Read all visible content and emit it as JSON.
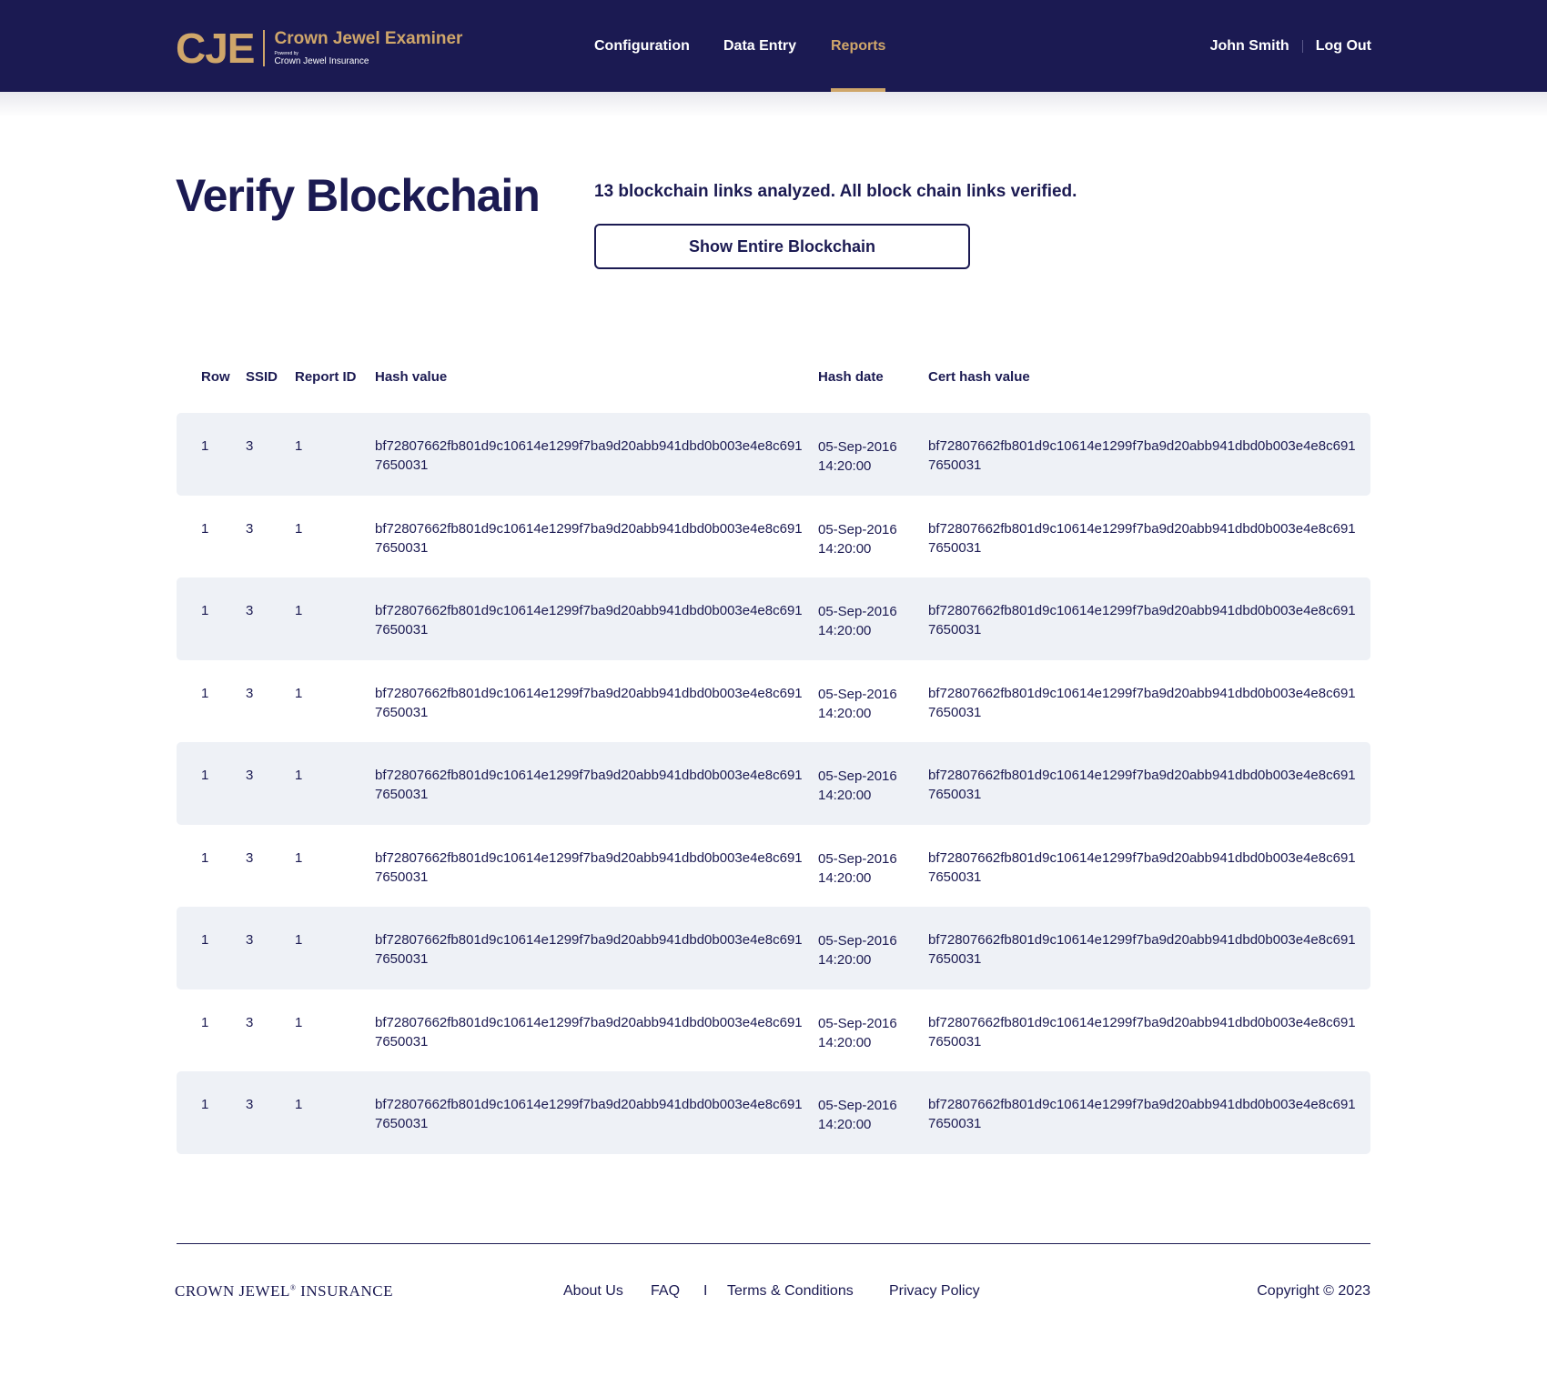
{
  "header": {
    "logo_mark": "CJE",
    "logo_title": "Crown Jewel Examiner",
    "logo_powered": "Powered by",
    "logo_subtitle": "Crown Jewel Insurance",
    "nav": [
      {
        "label": "Configuration",
        "active": false
      },
      {
        "label": "Data Entry",
        "active": false
      },
      {
        "label": "Reports",
        "active": true
      }
    ],
    "user_name": "John Smith",
    "logout_label": "Log Out"
  },
  "main": {
    "title": "Verify Blockchain",
    "status": "13 blockchain links analyzed. All block chain links verified.",
    "show_button_label": "Show Entire Blockchain"
  },
  "table": {
    "columns": [
      "Row",
      "SSID",
      "Report ID",
      "Hash value",
      "Hash date",
      "Cert hash value"
    ],
    "rows": [
      {
        "row": "1",
        "ssid": "3",
        "report_id": "1",
        "hash": "bf72807662fb801d9c10614e1299f7ba9d20abb941dbd0b003e4e8c6917650031",
        "date_line1": "05-Sep-2016",
        "date_line2": "14:20:00",
        "cert_hash": "bf72807662fb801d9c10614e1299f7ba9d20abb941dbd0b003e4e8c6917650031"
      },
      {
        "row": "1",
        "ssid": "3",
        "report_id": "1",
        "hash": "bf72807662fb801d9c10614e1299f7ba9d20abb941dbd0b003e4e8c6917650031",
        "date_line1": "05-Sep-2016",
        "date_line2": "14:20:00",
        "cert_hash": "bf72807662fb801d9c10614e1299f7ba9d20abb941dbd0b003e4e8c6917650031"
      },
      {
        "row": "1",
        "ssid": "3",
        "report_id": "1",
        "hash": "bf72807662fb801d9c10614e1299f7ba9d20abb941dbd0b003e4e8c6917650031",
        "date_line1": "05-Sep-2016",
        "date_line2": "14:20:00",
        "cert_hash": "bf72807662fb801d9c10614e1299f7ba9d20abb941dbd0b003e4e8c6917650031"
      },
      {
        "row": "1",
        "ssid": "3",
        "report_id": "1",
        "hash": "bf72807662fb801d9c10614e1299f7ba9d20abb941dbd0b003e4e8c6917650031",
        "date_line1": "05-Sep-2016",
        "date_line2": "14:20:00",
        "cert_hash": "bf72807662fb801d9c10614e1299f7ba9d20abb941dbd0b003e4e8c6917650031"
      },
      {
        "row": "1",
        "ssid": "3",
        "report_id": "1",
        "hash": "bf72807662fb801d9c10614e1299f7ba9d20abb941dbd0b003e4e8c6917650031",
        "date_line1": "05-Sep-2016",
        "date_line2": "14:20:00",
        "cert_hash": "bf72807662fb801d9c10614e1299f7ba9d20abb941dbd0b003e4e8c6917650031"
      },
      {
        "row": "1",
        "ssid": "3",
        "report_id": "1",
        "hash": "bf72807662fb801d9c10614e1299f7ba9d20abb941dbd0b003e4e8c6917650031",
        "date_line1": "05-Sep-2016",
        "date_line2": "14:20:00",
        "cert_hash": "bf72807662fb801d9c10614e1299f7ba9d20abb941dbd0b003e4e8c6917650031"
      },
      {
        "row": "1",
        "ssid": "3",
        "report_id": "1",
        "hash": "bf72807662fb801d9c10614e1299f7ba9d20abb941dbd0b003e4e8c6917650031",
        "date_line1": "05-Sep-2016",
        "date_line2": "14:20:00",
        "cert_hash": "bf72807662fb801d9c10614e1299f7ba9d20abb941dbd0b003e4e8c6917650031"
      },
      {
        "row": "1",
        "ssid": "3",
        "report_id": "1",
        "hash": "bf72807662fb801d9c10614e1299f7ba9d20abb941dbd0b003e4e8c6917650031",
        "date_line1": "05-Sep-2016",
        "date_line2": "14:20:00",
        "cert_hash": "bf72807662fb801d9c10614e1299f7ba9d20abb941dbd0b003e4e8c6917650031"
      },
      {
        "row": "1",
        "ssid": "3",
        "report_id": "1",
        "hash": "bf72807662fb801d9c10614e1299f7ba9d20abb941dbd0b003e4e8c6917650031",
        "date_line1": "05-Sep-2016",
        "date_line2": "14:20:00",
        "cert_hash": "bf72807662fb801d9c10614e1299f7ba9d20abb941dbd0b003e4e8c6917650031"
      }
    ]
  },
  "footer": {
    "brand": "CROWN JEWEL",
    "brand_mark": "®",
    "brand_suffix": "INSURANCE",
    "links": [
      "About Us",
      "FAQ",
      "Terms & Conditions",
      "Privacy Policy"
    ],
    "separator": "I",
    "copyright": "Copyright © 2023"
  },
  "colors": {
    "navy": "#1b1a52",
    "gold": "#cfa66a",
    "row_shade": "#eef1f6"
  }
}
